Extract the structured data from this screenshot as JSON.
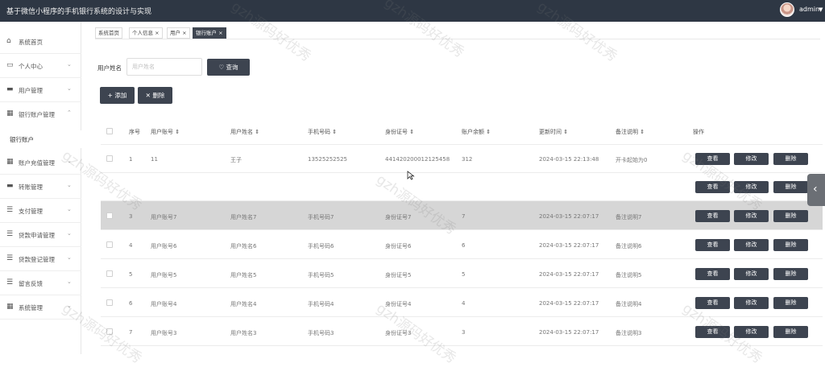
{
  "app": {
    "title": "基于微信小程序的手机银行系统的设计与实现",
    "user": "admin",
    "colors": {
      "topbar": "#2e3744",
      "button": "#3d4450",
      "highlight_row": "#d6d6d6"
    }
  },
  "sidebar": {
    "items": [
      {
        "label": "系统首页",
        "icon": "home-icon"
      },
      {
        "label": "个人中心",
        "icon": "user-card-icon"
      },
      {
        "label": "用户管理",
        "icon": "users-icon"
      },
      {
        "label": "银行账户管理",
        "icon": "grid-icon",
        "expanded": true
      },
      {
        "label": "账户充值管理",
        "icon": "grid-icon"
      },
      {
        "label": "转账管理",
        "icon": "wallet-icon"
      },
      {
        "label": "支付管理",
        "icon": "list-icon"
      },
      {
        "label": "贷款申请管理",
        "icon": "list-icon"
      },
      {
        "label": "贷款登记管理",
        "icon": "list-icon"
      },
      {
        "label": "留言反馈",
        "icon": "list-icon"
      },
      {
        "label": "系统管理",
        "icon": "grid-icon"
      }
    ],
    "sub_item": "银行账户"
  },
  "tabs": [
    {
      "label": "系统首页"
    },
    {
      "label": "个人信息 ×"
    },
    {
      "label": "用户 ×"
    },
    {
      "label": "银行账户 ×",
      "active": true
    }
  ],
  "search": {
    "label": "用户姓名",
    "placeholder": "用户姓名",
    "button": "♡ 查询"
  },
  "actions": {
    "add": "+ 添加",
    "delete": "✕ 删除"
  },
  "table": {
    "headers": [
      "序号",
      "用户账号 ⇕",
      "用户姓名 ⇕",
      "手机号码 ⇕",
      "身份证号 ⇕",
      "账户余额 ⇕",
      "更新时间 ⇕",
      "备注说明 ⇕",
      "操作"
    ],
    "row_buttons": {
      "view": "查看",
      "edit": "修改",
      "delete": "删除"
    },
    "rows": [
      {
        "no": "1",
        "account": "11",
        "name": "王子",
        "phone": "13525252525",
        "idno": "441420200012125458",
        "balance": "312",
        "time": "2024-03-15 22:13:48",
        "note": "开卡起始为0"
      },
      {
        "no": "",
        "account": "",
        "name": "",
        "phone": "",
        "idno": "",
        "balance": "",
        "time": "",
        "note": ""
      },
      {
        "no": "3",
        "account": "用户账号7",
        "name": "用户姓名7",
        "phone": "手机号码7",
        "idno": "身份证号7",
        "balance": "7",
        "time": "2024-03-15 22:07:17",
        "note": "备注说明7"
      },
      {
        "no": "4",
        "account": "用户账号6",
        "name": "用户姓名6",
        "phone": "手机号码6",
        "idno": "身份证号6",
        "balance": "6",
        "time": "2024-03-15 22:07:17",
        "note": "备注说明6"
      },
      {
        "no": "5",
        "account": "用户账号5",
        "name": "用户姓名5",
        "phone": "手机号码5",
        "idno": "身份证号5",
        "balance": "5",
        "time": "2024-03-15 22:07:17",
        "note": "备注说明5"
      },
      {
        "no": "6",
        "account": "用户账号4",
        "name": "用户姓名4",
        "phone": "手机号码4",
        "idno": "身份证号4",
        "balance": "4",
        "time": "2024-03-15 22:07:17",
        "note": "备注说明4"
      },
      {
        "no": "7",
        "account": "用户账号3",
        "name": "用户姓名3",
        "phone": "手机号码3",
        "idno": "身份证号3",
        "balance": "3",
        "time": "2024-03-15 22:07:17",
        "note": "备注说明3"
      }
    ]
  },
  "watermark": "gzh源码好优秀"
}
